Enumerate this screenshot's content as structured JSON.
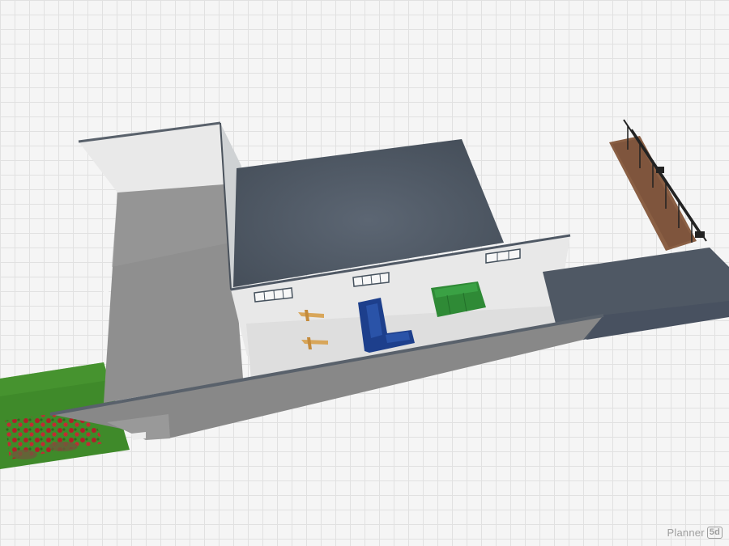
{
  "app": {
    "brand": "Planner",
    "brand_badge": "5d"
  },
  "colors": {
    "grid_background": "#f5f5f5",
    "grid_line": "#e1e1e1",
    "floor_left": "#8e8e8e",
    "floor_room": "#4f5864",
    "wall_top": "#cfd2d4",
    "wall_face": "#e8e8e8",
    "sofa_l_blue": "#1d3f8c",
    "sofa_green": "#2f8a36",
    "lawn": "#3f8a2a",
    "flowers": "#b0202a",
    "bracket_wood": "#d8a65a",
    "railing": "#222222"
  },
  "scene": {
    "objects": [
      "floor-plan",
      "left-wing-floor",
      "main-room-floor",
      "terrace-floor",
      "lawn",
      "flower-bed",
      "windows",
      "blue-l-sofa",
      "green-sofa",
      "wall-brackets",
      "stair-railing"
    ]
  }
}
